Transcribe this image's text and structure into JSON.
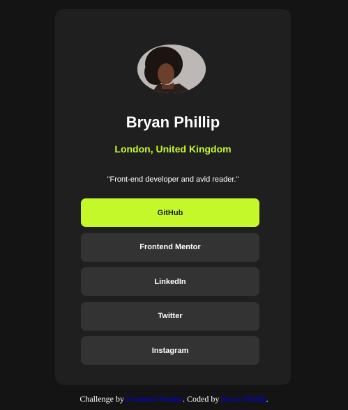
{
  "profile": {
    "name": "Bryan Phillip",
    "location": "London, United Kingdom",
    "bio": "\"Front-end developer and avid reader.\""
  },
  "links": [
    {
      "label": "GitHub"
    },
    {
      "label": "Frontend Mentor"
    },
    {
      "label": "LinkedIn"
    },
    {
      "label": "Twitter"
    },
    {
      "label": "Instagram"
    }
  ],
  "attribution": {
    "prefix": "Challenge by",
    "challenge_link": "Frontend Mentor",
    "middle": ". Coded by",
    "author_link": "Bryan Phillip",
    "suffix": "."
  },
  "colors": {
    "background": "#141414",
    "card": "#1f1f1f",
    "accent": "#c4f82a",
    "button": "#333333",
    "link": "#0000ee"
  }
}
